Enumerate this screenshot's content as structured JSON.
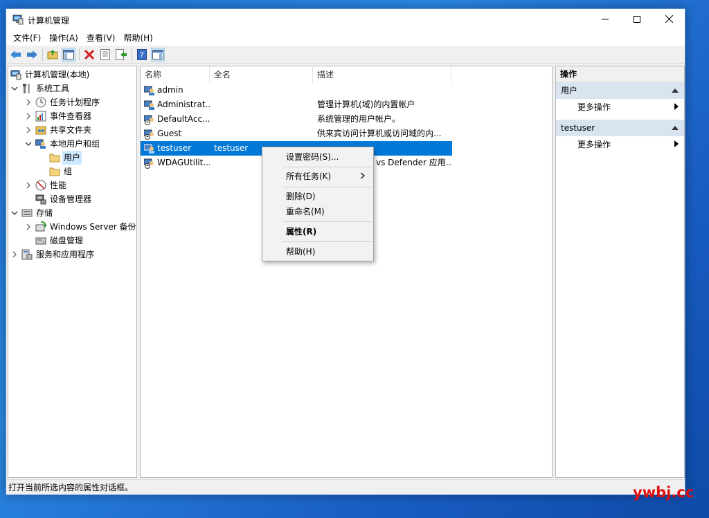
{
  "window": {
    "title": "计算机管理",
    "menus": [
      "文件(F)",
      "操作(A)",
      "查看(V)",
      "帮助(H)"
    ]
  },
  "toolbar": {
    "icons": [
      "back-arrow-icon",
      "forward-arrow-icon",
      "up-folder-icon",
      "show-hide-tree-icon",
      "delete-icon",
      "properties-icon",
      "export-list-icon",
      "help-icon",
      "show-action-pane-icon"
    ]
  },
  "tree": {
    "root": "计算机管理(本地)",
    "system_tools": "系统工具",
    "task_scheduler": "任务计划程序",
    "event_viewer": "事件查看器",
    "shared_folders": "共享文件夹",
    "local_users_groups": "本地用户和组",
    "users": "用户",
    "groups": "组",
    "performance": "性能",
    "device_manager": "设备管理器",
    "storage": "存储",
    "windows_server_backup": "Windows Server 备份",
    "disk_management": "磁盘管理",
    "services_apps": "服务和应用程序"
  },
  "list": {
    "headers": {
      "name": "名称",
      "fullname": "全名",
      "description": "描述"
    },
    "rows": [
      {
        "name": "admin",
        "fullname": "",
        "description": ""
      },
      {
        "name": "Administrat...",
        "fullname": "",
        "description": "管理计算机(域)的内置帐户"
      },
      {
        "name": "DefaultAcc...",
        "fullname": "",
        "description": "系统管理的用户帐户。"
      },
      {
        "name": "Guest",
        "fullname": "",
        "description": "供来宾访问计算机或访问域的内..."
      },
      {
        "name": "testuser",
        "fullname": "testuser",
        "description": ""
      },
      {
        "name": "WDAGUtilit...",
        "fullname": "",
        "description": "vs Defender 应用..."
      }
    ]
  },
  "context_menu": {
    "set_password": "设置密码(S)...",
    "all_tasks": "所有任务(K)",
    "delete": "删除(D)",
    "rename": "重命名(M)",
    "properties": "属性(R)",
    "help": "帮助(H)"
  },
  "actions": {
    "title": "操作",
    "section1": "用户",
    "more1": "更多操作",
    "section2": "testuser",
    "more2": "更多操作"
  },
  "status": {
    "text": "打开当前所选内容的属性对话框。"
  },
  "watermark": "ywbj.cc",
  "colors": {
    "selection": "#0078d7",
    "tree_selection": "#cce8ff",
    "action_section": "#d9e4f1",
    "desktop": "#1d6fd1",
    "watermark": "#e01010"
  }
}
